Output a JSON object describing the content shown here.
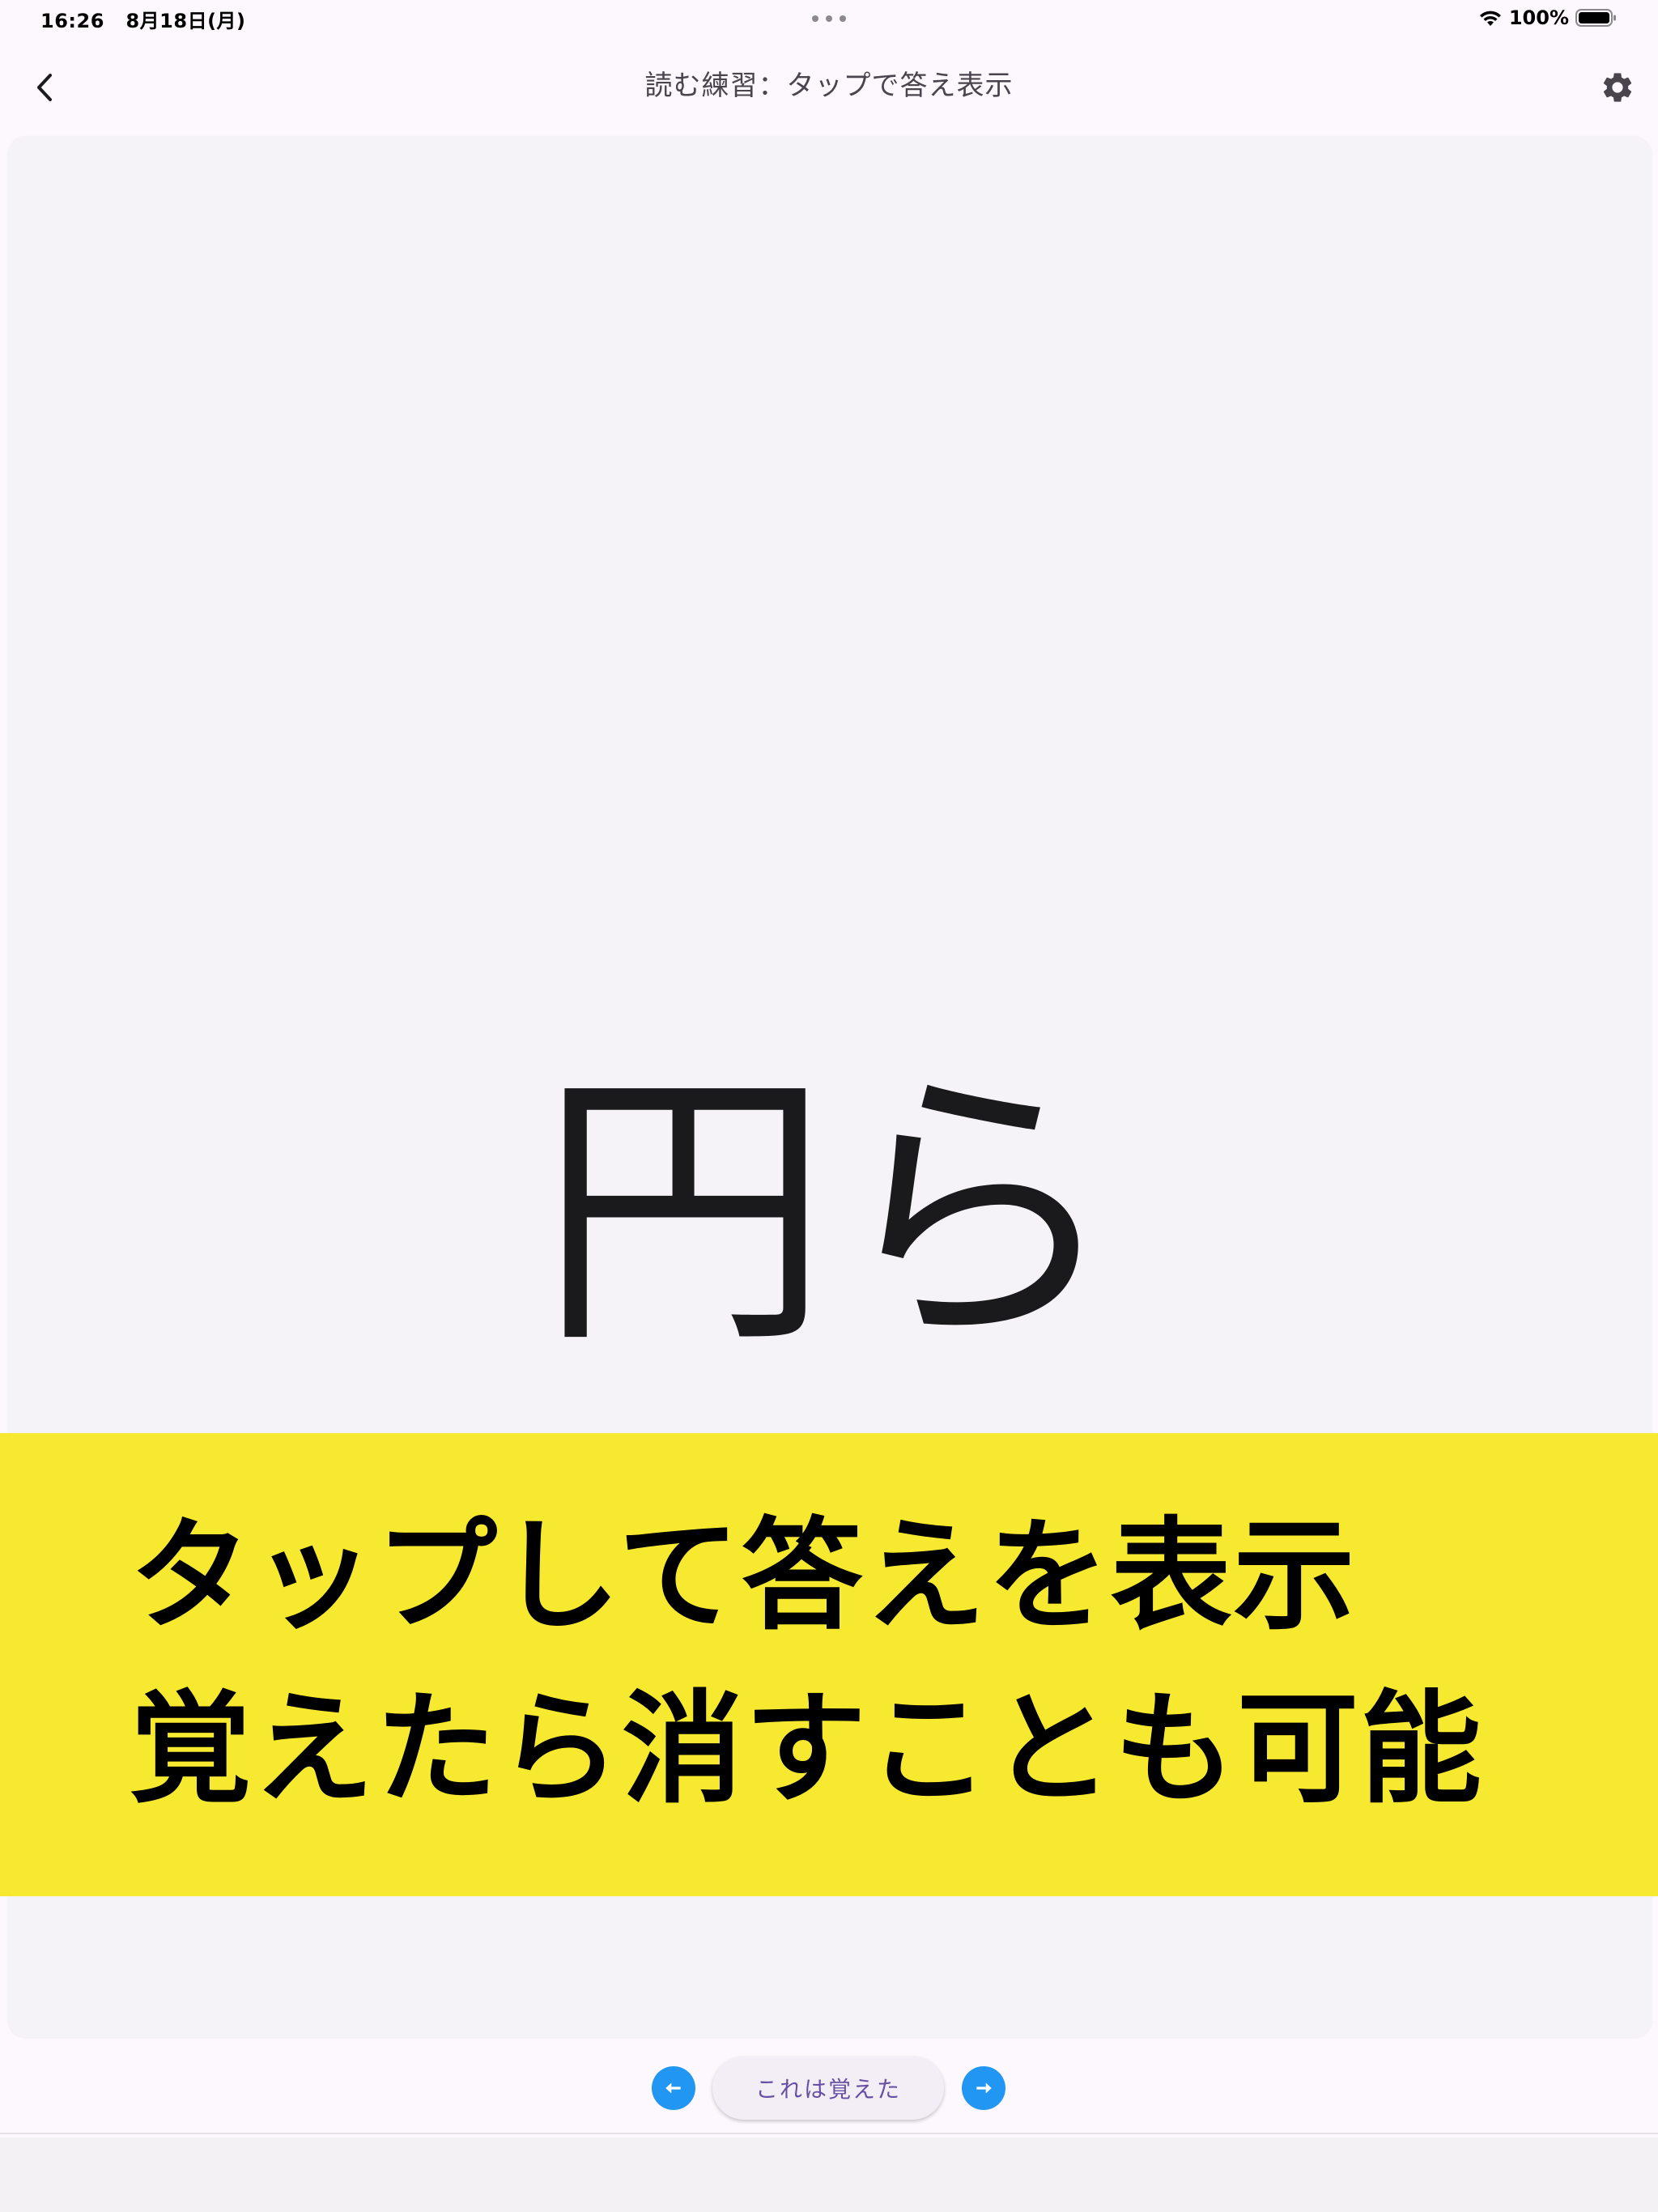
{
  "status_bar": {
    "time": "16:26",
    "date": "8月18日(月)",
    "battery": "100%"
  },
  "app_bar": {
    "title": "読む練習：タップで答え表示",
    "back_icon": "chevron-left-icon",
    "settings_icon": "gear-icon"
  },
  "card": {
    "question": "円ら"
  },
  "overlay": {
    "line1": "タップして答えを表示",
    "line2": "覚えたら消すことも可能",
    "color": "#f7e92f"
  },
  "controls": {
    "memorized_label": "これは覚えた",
    "prev_icon": "arrow-left-icon",
    "next_icon": "arrow-right-icon",
    "accent": "#2196f3"
  }
}
